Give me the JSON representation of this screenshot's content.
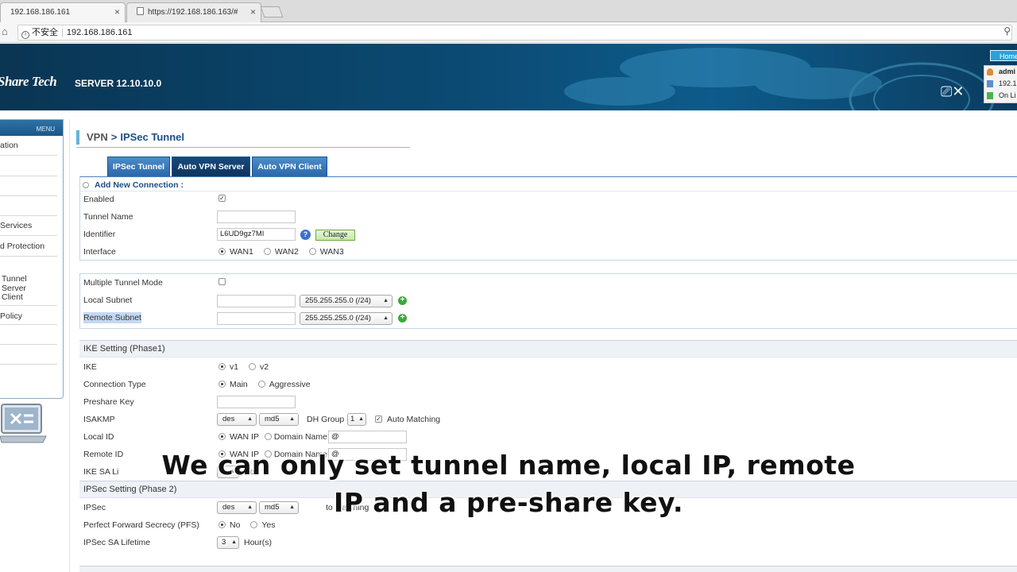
{
  "browser": {
    "tabs": [
      {
        "title": "192.168.186.161",
        "active": true
      },
      {
        "title": "https://192.168.186.163/#",
        "active": false
      }
    ],
    "close_glyph": "×",
    "security_label": "不安全",
    "url": "192.168.186.161"
  },
  "banner": {
    "logo": "Share Tech",
    "server": "SERVER 12.10.10.0",
    "home_label": "Home",
    "user": {
      "name": "admi",
      "ip": "192.1",
      "status": "On Li"
    }
  },
  "sidebar": {
    "menu_label": "MENU",
    "items": [
      "ation",
      "Services",
      "d Protection",
      "Tunnel",
      "Server",
      "Client",
      "Policy"
    ]
  },
  "breadcrumb": {
    "section": "VPN",
    "separator": ">",
    "page": "IPSec Tunnel"
  },
  "tabs": [
    {
      "label": "IPSec Tunnel",
      "active": false
    },
    {
      "label": "Auto VPN Server",
      "active": true
    },
    {
      "label": "Auto VPN Client",
      "active": false
    }
  ],
  "form": {
    "add_title": "Add New Connection :",
    "enabled_label": "Enabled",
    "tunnel_name_label": "Tunnel Name",
    "tunnel_name_value": "",
    "identifier_label": "Identifier",
    "identifier_value": "L6UD9gz7MI",
    "change_label": "Change",
    "interface_label": "Interface",
    "interface_options": [
      "WAN1",
      "WAN2",
      "WAN3"
    ],
    "multi_tunnel_label": "Multiple Tunnel Mode",
    "local_subnet_label": "Local Subnet",
    "local_subnet_mask": "255.255.255.0 (/24)",
    "remote_subnet_label": "Remote Subnet",
    "remote_subnet_mask": "255.255.255.0 (/24)",
    "ike_section": "IKE Setting (Phase1)",
    "ike_label": "IKE",
    "ike_v1": "v1",
    "ike_v2": "v2",
    "conn_type_label": "Connection Type",
    "conn_main": "Main",
    "conn_aggr": "Aggressive",
    "preshare_label": "Preshare Key",
    "isakmp_label": "ISAKMP",
    "isakmp_enc": "des",
    "isakmp_hash": "md5",
    "dh_group_label": "DH Group",
    "dh_group_value": "1",
    "auto_matching_label": "Auto Matching",
    "local_id_label": "Local ID",
    "remote_id_label": "Remote ID",
    "wan_ip_label": "WAN IP",
    "domain_name_label": "Domain Name",
    "domain_placeholder": "@",
    "ike_sa_label": "IKE SA Li",
    "ike_sa_unit": "Ho",
    "ipsec_section": "IPSec Setting (Phase 2)",
    "ipsec_label": "IPSec",
    "ipsec_enc": "des",
    "ipsec_hash": "md5",
    "ipsec_auto_matching": "to Matching",
    "pfs_label": "Perfect Forward Secrecy (PFS)",
    "pfs_no": "No",
    "pfs_yes": "Yes",
    "ipsec_sa_label": "IPSec SA Lifetime",
    "ipsec_sa_value": "3",
    "ipsec_sa_unit": "Hour(s)"
  },
  "caption": {
    "line1": "We can only set tunnel name, local IP, remote",
    "line2": "IP and  a pre-share key."
  },
  "colors": {
    "banner": "#0b4a73",
    "tab_active": "#0d355e",
    "tab": "#2a68aa",
    "accent": "#63b4d8"
  }
}
